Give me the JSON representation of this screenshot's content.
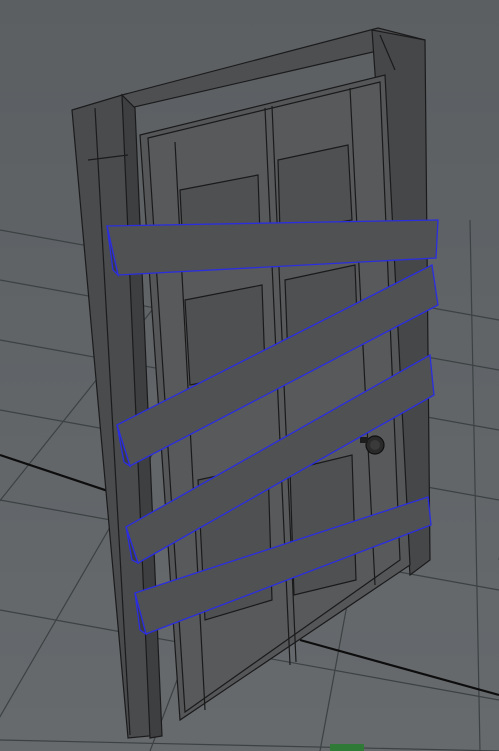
{
  "viewport": {
    "label": "",
    "background": "#5f6366",
    "grid_color": "#3f4447",
    "grid_major_color": "#111111"
  },
  "door": {
    "object_name": "",
    "frame_color": "#4b4c4e",
    "panel_color": "#555658",
    "edge_color": "#1b1b1c",
    "selection_edge_color": "#2b2ee0"
  },
  "boards": {
    "count": 4,
    "color": "#505153"
  }
}
